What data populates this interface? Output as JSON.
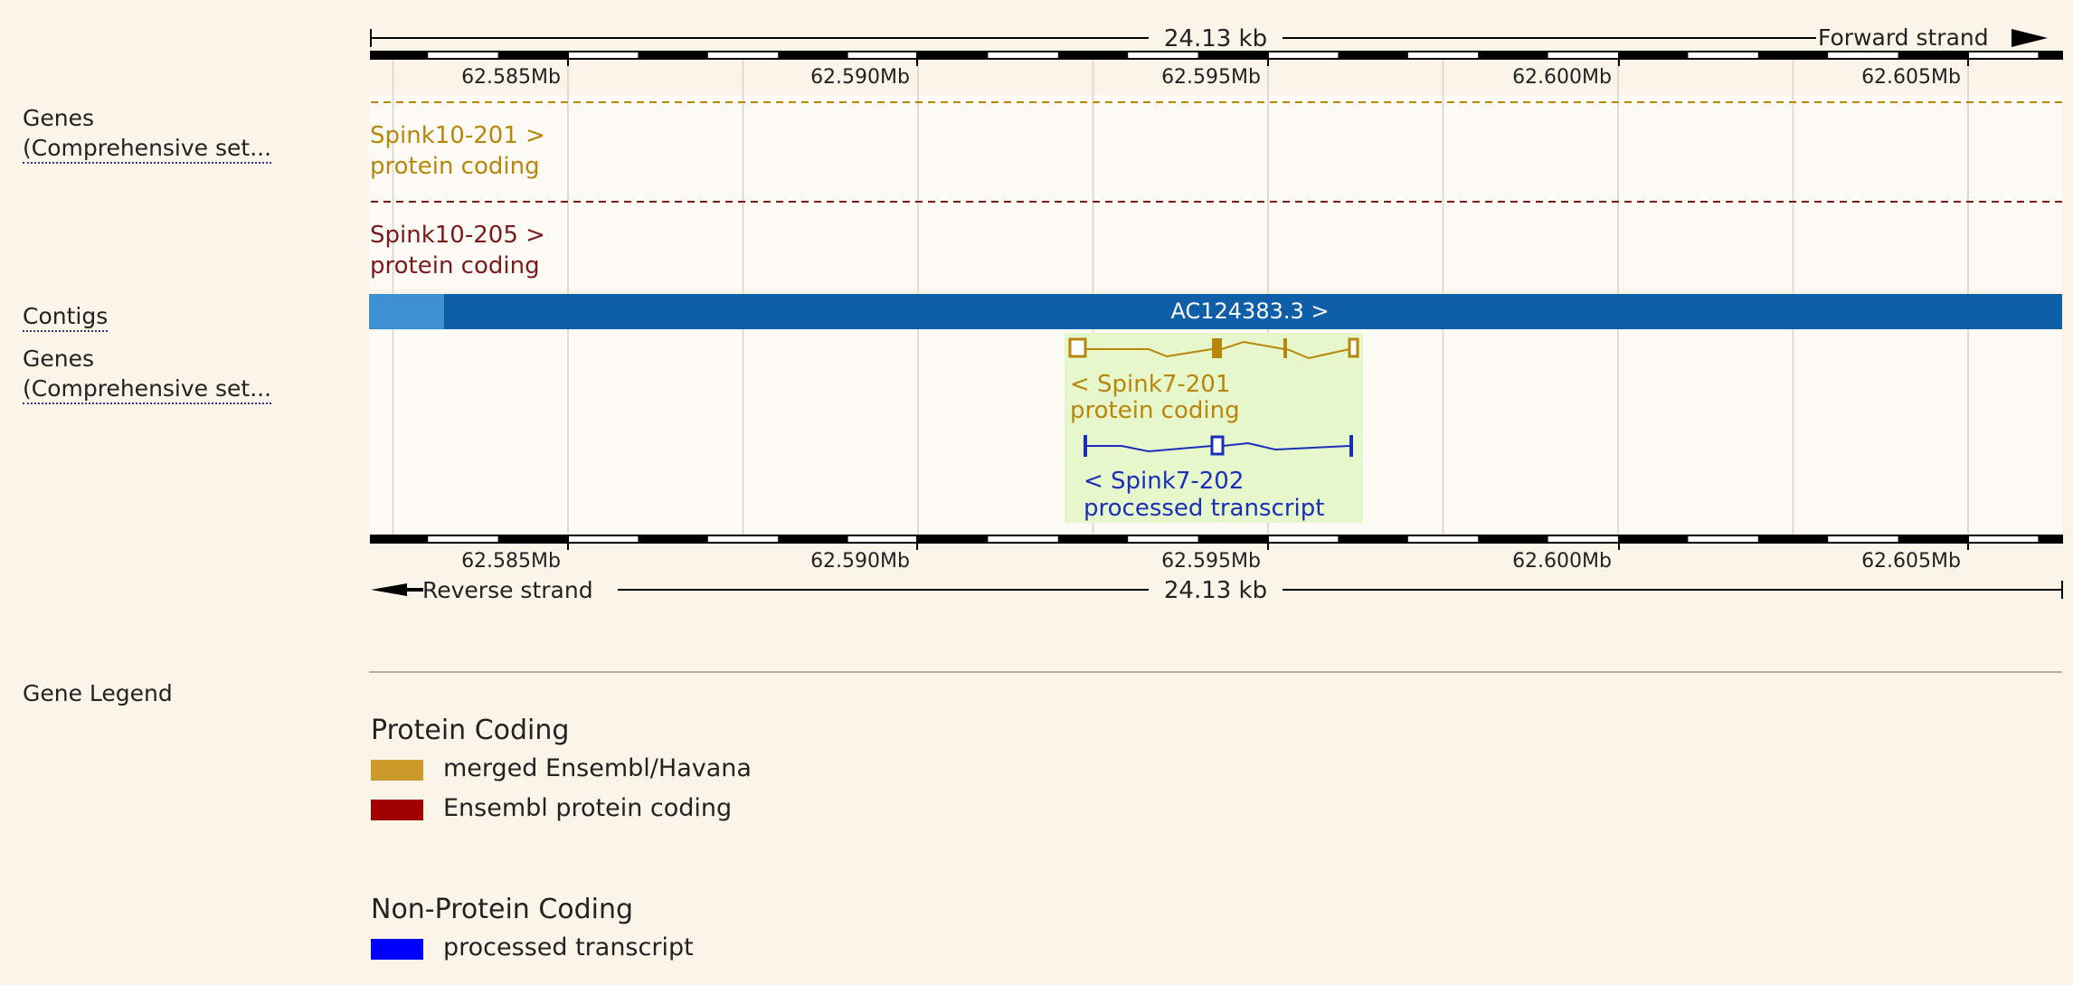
{
  "scale": {
    "span_label": "24.13 kb",
    "forward_strand": "Forward strand",
    "reverse_strand": "Reverse strand",
    "ticks": [
      "62.585Mb",
      "62.590Mb",
      "62.595Mb",
      "62.600Mb",
      "62.605Mb"
    ]
  },
  "tracks": {
    "forward_genes_label": "Genes",
    "forward_genes_sublabel": "(Comprehensive set...",
    "contigs_label": "Contigs",
    "reverse_genes_label": "Genes",
    "reverse_genes_sublabel": "(Comprehensive set..."
  },
  "features": {
    "spink10_201": {
      "name": "Spink10-201 >",
      "type": "protein coding"
    },
    "spink10_205": {
      "name": "Spink10-205 >",
      "type": "protein coding"
    },
    "contig": {
      "name": "AC124383.3 >"
    },
    "spink7_201": {
      "name": "< Spink7-201",
      "type": "protein coding"
    },
    "spink7_202": {
      "name": "< Spink7-202",
      "type": "processed transcript"
    }
  },
  "legend": {
    "title": "Gene Legend",
    "groups": [
      {
        "heading": "Protein Coding",
        "items": [
          {
            "label": "merged Ensembl/Havana",
            "color": "#cc9a2a"
          },
          {
            "label": "Ensembl protein coding",
            "color": "#a10000"
          }
        ]
      },
      {
        "heading": "Non-Protein Coding",
        "items": [
          {
            "label": "processed transcript",
            "color": "#0000ff"
          }
        ]
      }
    ]
  },
  "colors": {
    "merged": "#b8860b",
    "ensembl_coding": "#7a1a1a",
    "processed": "#1a2fb8",
    "contig": "#0e5ea8",
    "contig_light": "#3e8fd0",
    "highlight": "#e6f7cc"
  }
}
